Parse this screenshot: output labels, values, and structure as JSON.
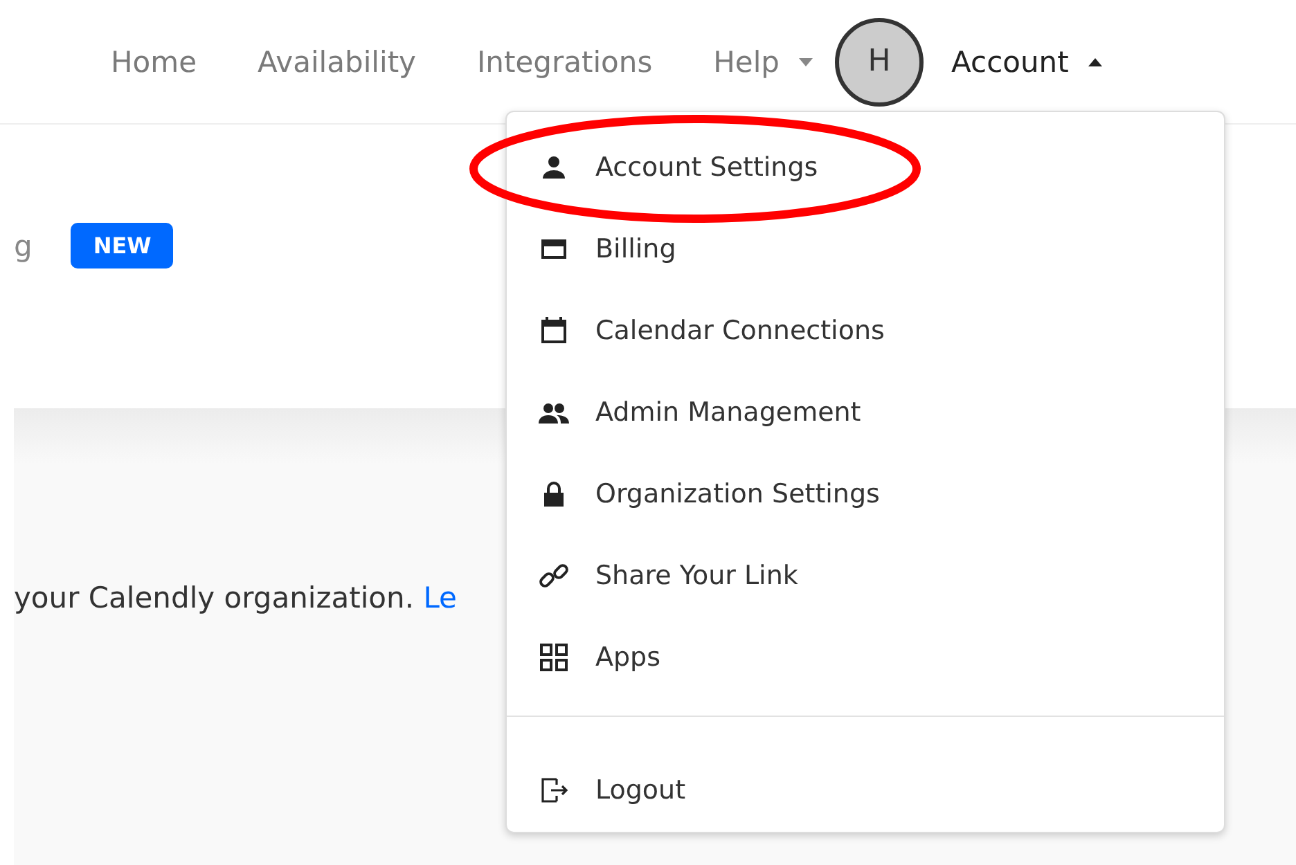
{
  "nav": [
    {
      "kind": "link",
      "label": "Home"
    },
    {
      "kind": "link",
      "label": "Availability"
    },
    {
      "kind": "link",
      "label": "Integrations"
    },
    {
      "kind": "dropdown",
      "label": "Help",
      "expanded": false
    },
    {
      "kind": "avatar",
      "label": "H"
    },
    {
      "kind": "dropdown",
      "label": "Account",
      "expanded": true
    }
  ],
  "header": {
    "tab_fragment": "g",
    "badge": "NEW"
  },
  "body": {
    "text": "your Calendly organization.",
    "link": "Le"
  },
  "account_menu": {
    "items": [
      {
        "label": "Account Settings",
        "highlighted": true
      },
      {
        "label": "Billing",
        "highlighted": false
      },
      {
        "label": "Calendar Connections",
        "highlighted": false
      },
      {
        "label": "Admin Management",
        "highlighted": false
      },
      {
        "label": "Organization Settings",
        "highlighted": false
      },
      {
        "label": "Share Your Link",
        "highlighted": false
      },
      {
        "label": "Apps",
        "highlighted": false
      }
    ],
    "footer_items": [
      {
        "label": "Logout"
      }
    ]
  }
}
